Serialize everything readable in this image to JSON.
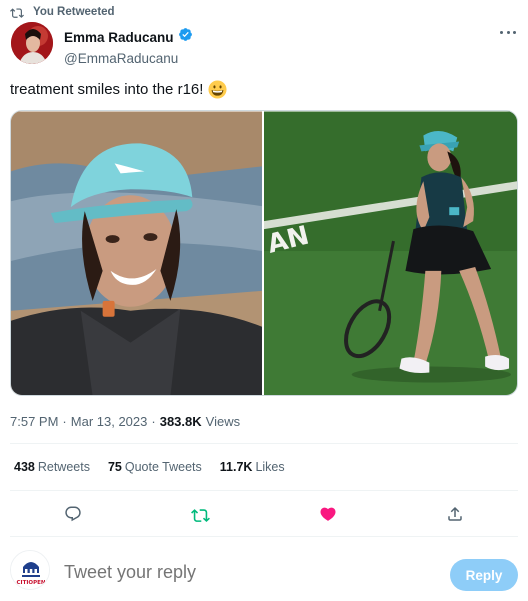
{
  "retweet_banner": {
    "label": "You Retweeted",
    "icon": "retweet-icon"
  },
  "author": {
    "display_name": "Emma Raducanu",
    "handle": "@EmmaRaducanu",
    "verified": true,
    "verified_icon": "verified-badge-icon"
  },
  "tweet": {
    "text": "treatment smiles into the r16!",
    "emoji": "grinning-face-emoji"
  },
  "media": [
    {
      "name": "selfie-photo",
      "description": "selfie photo"
    },
    {
      "name": "court-photo",
      "description": "tennis court photo"
    }
  ],
  "meta": {
    "time": "7:57 PM",
    "sep1": "·",
    "date": "Mar 13, 2023",
    "sep2": "·",
    "views_count": "383.8K",
    "views_label": "Views"
  },
  "stats": {
    "retweets": {
      "count": "438",
      "label": "Retweets"
    },
    "quote_tweets": {
      "count": "75",
      "label": "Quote Tweets"
    },
    "likes": {
      "count": "11.7K",
      "label": "Likes"
    }
  },
  "actions": [
    "reply-icon",
    "retweet-icon",
    "like-icon",
    "share-icon"
  ],
  "colors": {
    "accent": "#1d9bf0",
    "retweet_green": "#00ba7c",
    "like_pink": "#f91880",
    "muted": "#536471"
  },
  "reply": {
    "placeholder": "Tweet your reply",
    "button_label": "Reply",
    "avatar_text": "CITIOPEN"
  }
}
